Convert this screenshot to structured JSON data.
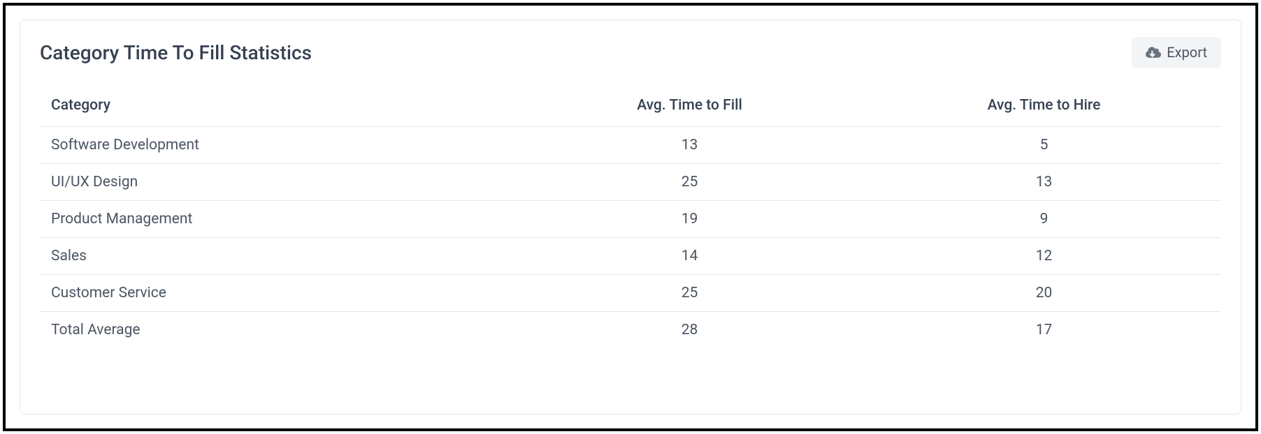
{
  "card": {
    "title": "Category Time To Fill Statistics",
    "export_label": "Export"
  },
  "table": {
    "headers": {
      "category": "Category",
      "avg_time_to_fill": "Avg. Time to Fill",
      "avg_time_to_hire": "Avg. Time to Hire"
    },
    "rows": [
      {
        "category": "Software Development",
        "avg_time_to_fill": "13",
        "avg_time_to_hire": "5"
      },
      {
        "category": "UI/UX Design",
        "avg_time_to_fill": "25",
        "avg_time_to_hire": "13"
      },
      {
        "category": "Product Management",
        "avg_time_to_fill": "19",
        "avg_time_to_hire": "9"
      },
      {
        "category": "Sales",
        "avg_time_to_fill": "14",
        "avg_time_to_hire": "12"
      },
      {
        "category": "Customer Service",
        "avg_time_to_fill": "25",
        "avg_time_to_hire": "20"
      },
      {
        "category": "Total Average",
        "avg_time_to_fill": "28",
        "avg_time_to_hire": "17"
      }
    ]
  }
}
